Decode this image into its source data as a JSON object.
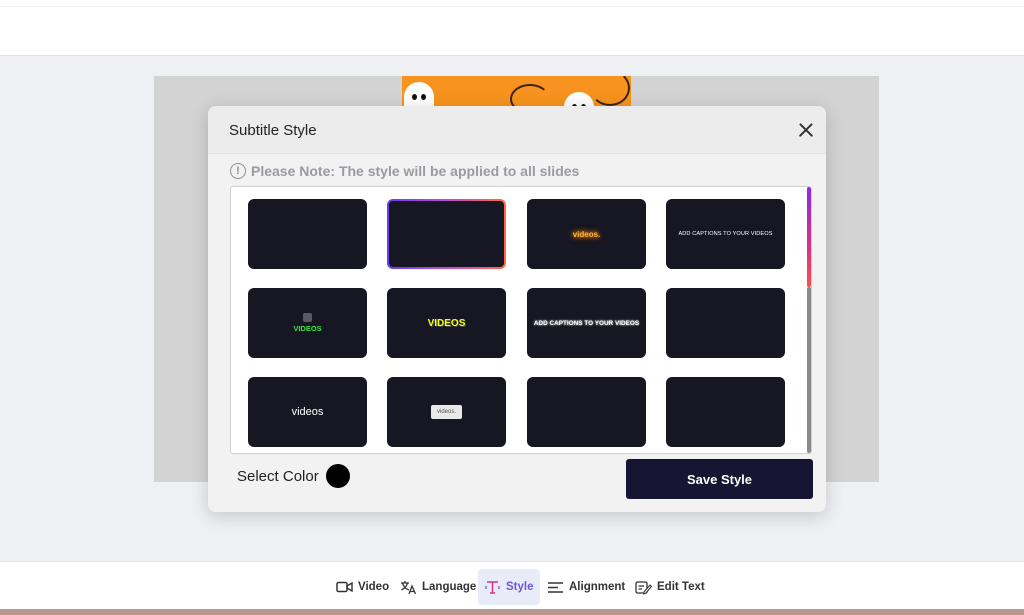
{
  "modal": {
    "title": "Subtitle Style",
    "note": "Please Note: The style will be applied to all slides",
    "select_color_label": "Select Color",
    "selected_color": "#000000",
    "save_label": "Save Style"
  },
  "styles": {
    "tiles": [
      {
        "text": ""
      },
      {
        "text": ""
      },
      {
        "text": "videos."
      },
      {
        "text": "ADD CAPTIONS TO YOUR VIDEOS"
      },
      {
        "text": "VIDEOS"
      },
      {
        "text": "VIDEOS"
      },
      {
        "text": "ADD CAPTIONS TO YOUR VIDEOS"
      },
      {
        "text": ""
      },
      {
        "text": "videos"
      },
      {
        "text": "videos."
      },
      {
        "text": ""
      },
      {
        "text": ""
      }
    ],
    "selected_index": 1
  },
  "toolbar": {
    "video": "Video",
    "language": "Language",
    "style": "Style",
    "alignment": "Alignment",
    "edit_text": "Edit Text",
    "active": "style"
  },
  "colors": {
    "accent": "#6f56d6",
    "save_button": "#161633",
    "tile_bg": "#161722",
    "preview_bg": "#f7931e"
  }
}
